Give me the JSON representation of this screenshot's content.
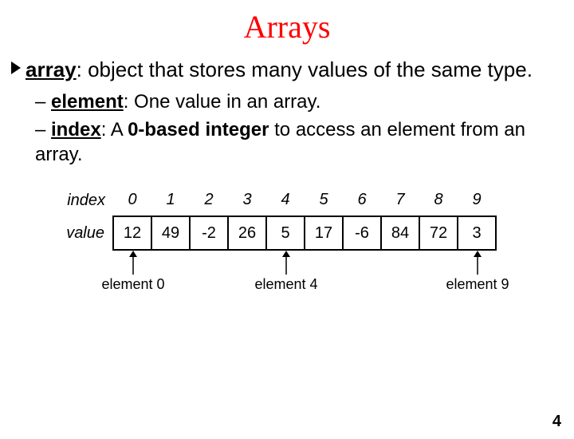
{
  "title": "Arrays",
  "bullet": {
    "term": "array",
    "rest": ": object that stores many values of the same type."
  },
  "sub": [
    {
      "dash": "– ",
      "term": "element",
      "rest": ": One value in an array."
    },
    {
      "dash": "– ",
      "term": "index",
      "rest1": ": A ",
      "bold": "0-based integer",
      "rest2": " to access an element from an array."
    }
  ],
  "table": {
    "row_labels": {
      "index": "index",
      "value": "value"
    },
    "indices": [
      "0",
      "1",
      "2",
      "3",
      "4",
      "5",
      "6",
      "7",
      "8",
      "9"
    ],
    "values": [
      "12",
      "49",
      "-2",
      "26",
      "5",
      "17",
      "-6",
      "84",
      "72",
      "3"
    ]
  },
  "labels": {
    "el0": "element 0",
    "el4": "element 4",
    "el9": "element 9"
  },
  "page_number": "4",
  "chart_data": {
    "type": "table",
    "title": "Arrays",
    "columns": [
      "index",
      "value"
    ],
    "rows": [
      {
        "index": 0,
        "value": 12
      },
      {
        "index": 1,
        "value": 49
      },
      {
        "index": 2,
        "value": -2
      },
      {
        "index": 3,
        "value": 26
      },
      {
        "index": 4,
        "value": 5
      },
      {
        "index": 5,
        "value": 17
      },
      {
        "index": 6,
        "value": -6
      },
      {
        "index": 7,
        "value": 84
      },
      {
        "index": 8,
        "value": 72
      },
      {
        "index": 9,
        "value": 3
      }
    ]
  }
}
